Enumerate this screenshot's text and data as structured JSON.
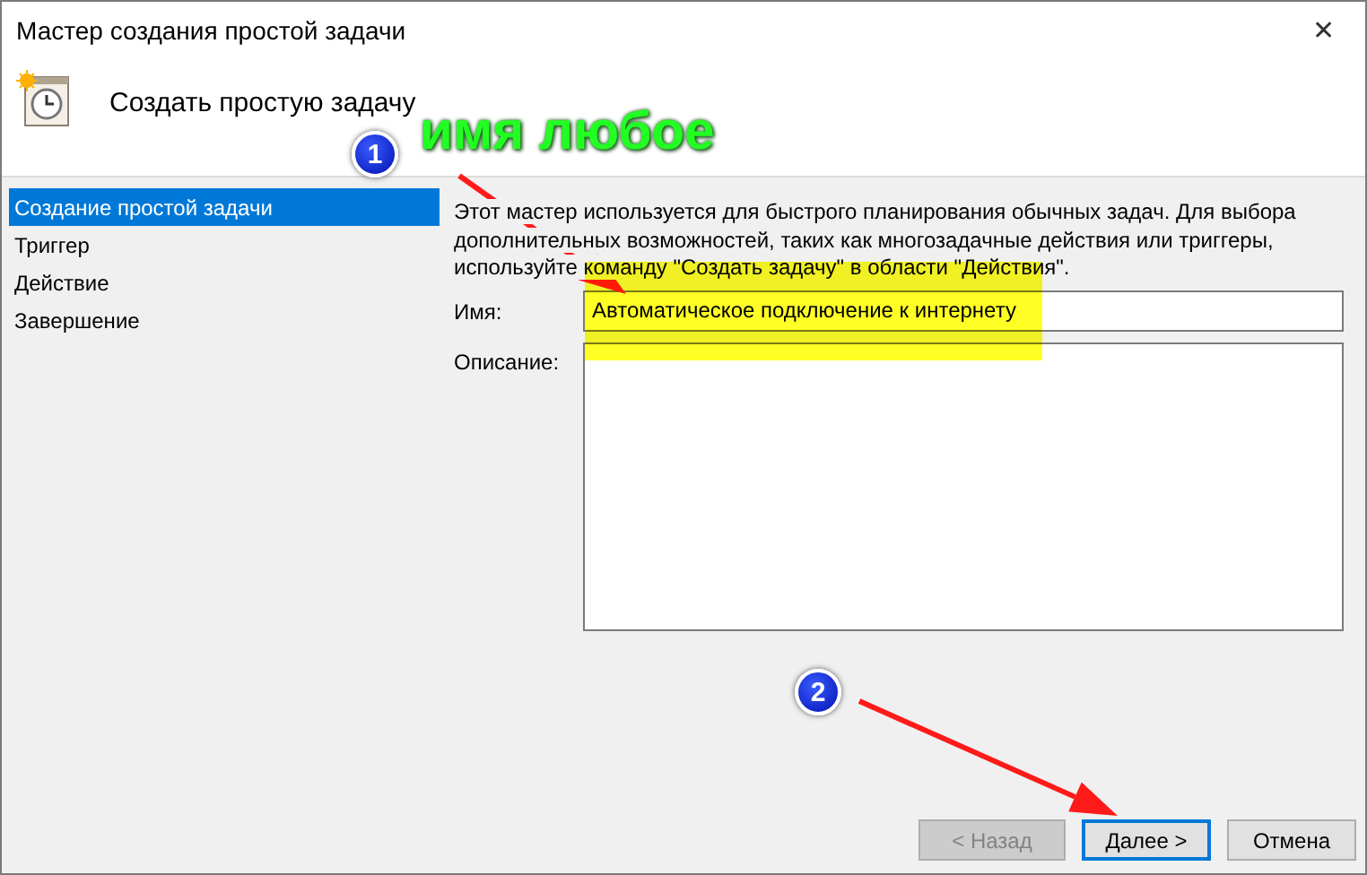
{
  "window": {
    "title": "Мастер создания простой задачи",
    "close": "✕"
  },
  "header": {
    "title": "Создать простую задачу"
  },
  "nav": [
    {
      "label": "Создание простой задачи",
      "selected": true
    },
    {
      "label": "Триггер",
      "selected": false
    },
    {
      "label": "Действие",
      "selected": false
    },
    {
      "label": "Завершение",
      "selected": false
    }
  ],
  "intro": "Этот мастер используется для быстрого планирования обычных задач.  Для выбора дополнительных возможностей, таких как многозадачные действия или триггеры, используйте команду \"Создать задачу\" в области \"Действия\".",
  "fields": [
    {
      "kind": "line",
      "label": "Имя:",
      "value": "Автоматическое подключение к интернету"
    },
    {
      "kind": "area",
      "label": "Описание:"
    }
  ],
  "buttons": [
    {
      "label": "< Назад",
      "disabled": true,
      "focused": false
    },
    {
      "label": "Далее >",
      "disabled": false,
      "focused": true
    },
    {
      "label": "Отмена",
      "disabled": false,
      "focused": false
    }
  ],
  "annotations": {
    "caption": "имя любое",
    "markers": [
      "1",
      "2"
    ]
  }
}
